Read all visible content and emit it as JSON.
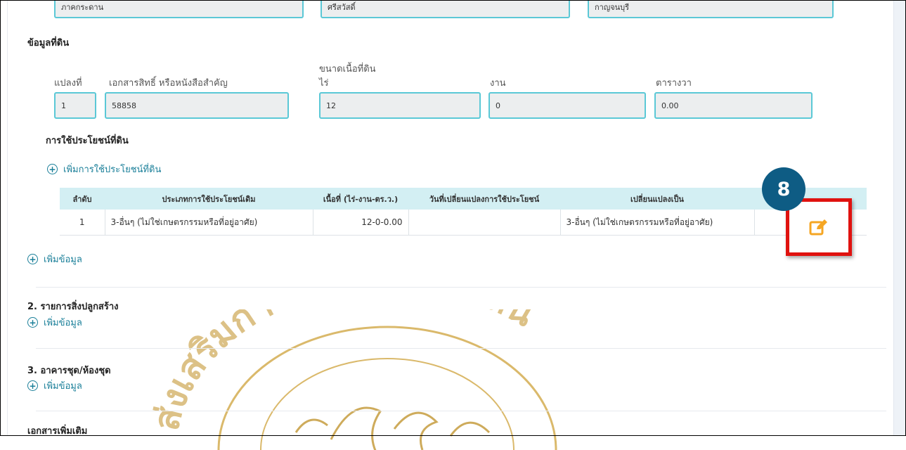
{
  "top_row": {
    "field_1": "ภาคกระดาน",
    "field_2": "ศรีสวัสดิ์",
    "field_3": "กาญจนบุรี"
  },
  "land_info": {
    "section_title": "ข้อมูลที่ดิน",
    "area_group_label": "ขนาดเนื้อที่ดิน",
    "labels": {
      "plot_no": "แปลงที่",
      "document": "เอกสารสิทธิ์ หรือหนังสือสำคัญ",
      "rai": "ไร่",
      "ngan": "งาน",
      "sq_wa": "ตารางวา"
    },
    "values": {
      "plot_no": "1",
      "document": "58858",
      "rai": "12",
      "ngan": "0",
      "sq_wa": "0.00"
    }
  },
  "land_use": {
    "title": "การใช้ประโยชน์ที่ดิน",
    "add_link": "เพิ่มการใช้ประโยชน์ที่ดิน",
    "columns": [
      "ลำดับ",
      "ประเภทการใช้ประโยชน์เดิม",
      "เนื้อที่ (ไร่-งาน-ตร.ว.)",
      "วันที่เปลี่ยนแปลงการใช้ประโยชน์",
      "เปลี่ยนแปลงเป็น"
    ],
    "rows": [
      {
        "no": "1",
        "original_use": "3-อื่นๆ (ไม่ใช่เกษตรกรรมหรือที่อยู่อาศัย)",
        "area": "12-0-0.00",
        "change_date": "",
        "changed_to": "3-อื่นๆ (ไม่ใช่เกษตรกรรมหรือที่อยู่อาศัย)"
      }
    ]
  },
  "add_data_1": "เพิ่มข้อมูล",
  "section2": {
    "title": "2. รายการสิ่งปลูกสร้าง",
    "add": "เพิ่มข้อมูล"
  },
  "section3": {
    "title": "3. อาคารชุด/ห้องชุด",
    "add": "เพิ่มข้อมูล"
  },
  "section4": {
    "title": "เอกสารเพิ่มเติม"
  },
  "annotation": {
    "step": "8"
  },
  "watermark": {
    "text": "ส่งเสริมการปกครองท้องถิ่น"
  },
  "colors": {
    "field_border": "#5bc8d6",
    "table_header_bg": "#d3eff3",
    "link": "#1a7f99",
    "badge": "#0e5c84",
    "highlight": "#e0120f",
    "edit_icon": "#f5a623"
  }
}
